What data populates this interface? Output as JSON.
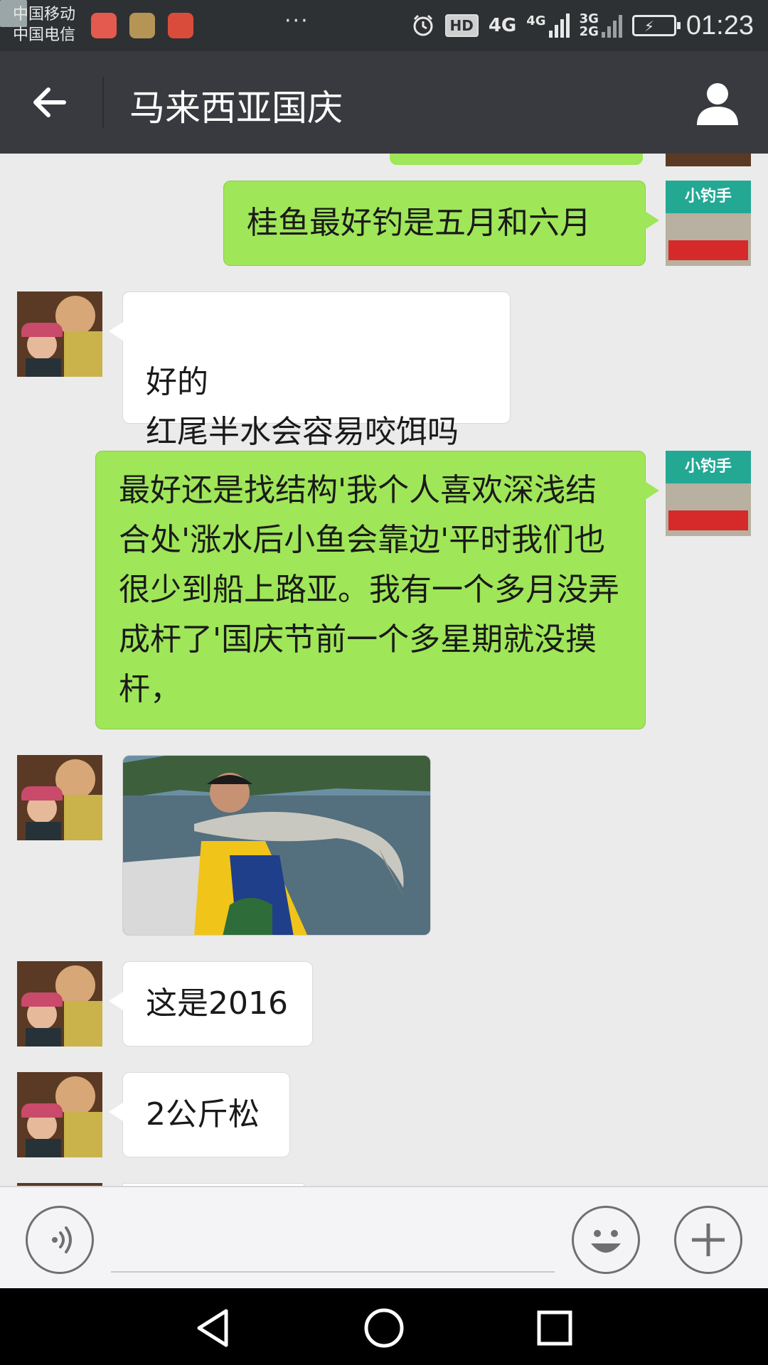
{
  "status_bar": {
    "carrier_1": "中国移动",
    "carrier_2": "中国电信",
    "more": "···",
    "hd": "HD",
    "net_1": "4G",
    "net_2": "4G",
    "net_3": "3G",
    "net_4": "2G",
    "time": "01:23",
    "icons": [
      "mail-app-icon",
      "health-app-icon",
      "cow-app-icon",
      "photo-notification-icon",
      "alarm-icon",
      "battery-charging-icon"
    ]
  },
  "header": {
    "title": "马来西亚国庆",
    "back_icon": "back-arrow-icon",
    "profile_icon": "person-icon"
  },
  "messages": [
    {
      "side": "me",
      "type": "text",
      "text": "桂鱼最好钓是五月和六月"
    },
    {
      "side": "them",
      "type": "text",
      "text": "好的\n红尾半水会容易咬饵吗"
    },
    {
      "side": "me",
      "type": "text",
      "text": "最好还是找结构'我个人喜欢深浅结合处'涨水后小鱼会靠边'平时我们也很少到船上路亚。我有一个多月没弄成杆了'国庆节前一个多星期就没摸杆，"
    },
    {
      "side": "them",
      "type": "image",
      "alt": "fishing photo"
    },
    {
      "side": "them",
      "type": "text",
      "text": "这是2016"
    },
    {
      "side": "them",
      "type": "text",
      "text": "2公斤松"
    }
  ],
  "my_avatar_text": "小钓手",
  "input_bar": {
    "voice_icon": "voice-icon",
    "emoji_icon": "emoji-icon",
    "plus_icon": "plus-icon"
  },
  "nav_bar": {
    "icons": [
      "nav-back-icon",
      "nav-home-icon",
      "nav-recent-icon"
    ]
  },
  "colors": {
    "status_bar": "#2e3133",
    "title_bar": "#393a3f",
    "chat_bg": "#ebebeb",
    "my_bubble": "#9fe658",
    "their_bubble": "#ffffff"
  }
}
